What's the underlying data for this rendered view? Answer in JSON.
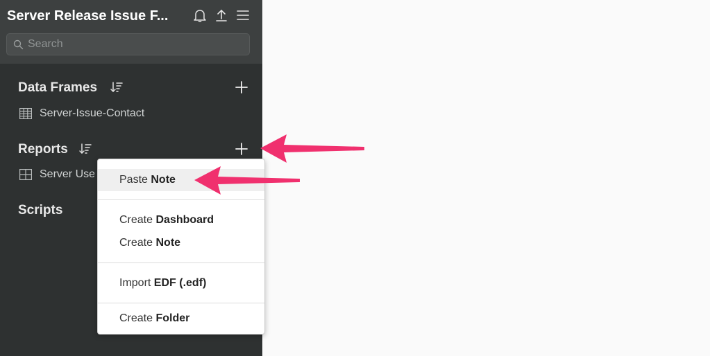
{
  "app": {
    "title": "Server Release Issue F..."
  },
  "header_icons": [
    "bell-icon",
    "upload-icon",
    "menu-icon"
  ],
  "search": {
    "placeholder": "Search",
    "value": ""
  },
  "sections": {
    "data_frames": {
      "title": "Data Frames",
      "items": [
        {
          "label": "Server-Issue-Contact",
          "icon": "table-icon"
        }
      ]
    },
    "reports": {
      "title": "Reports",
      "items": [
        {
          "label": "Server Use",
          "icon": "dashboard-icon"
        }
      ]
    },
    "scripts": {
      "title": "Scripts"
    }
  },
  "context_menu": {
    "items": [
      {
        "prefix": "Paste",
        "bold": "Note"
      },
      {
        "prefix": "Create",
        "bold": "Dashboard"
      },
      {
        "prefix": "Create",
        "bold": "Note"
      },
      {
        "prefix": "Import",
        "bold": "EDF (.edf)"
      },
      {
        "prefix": "Create",
        "bold": "Folder"
      }
    ]
  },
  "colors": {
    "sidebar_bg": "#2e3131",
    "header_bg": "#3d4040",
    "arrow": "#f0306e"
  }
}
